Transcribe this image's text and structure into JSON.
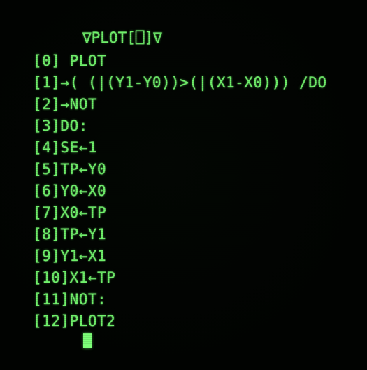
{
  "editor": {
    "header": "∇PLOT[⎕]∇",
    "lines": [
      "[0] PLOT",
      "[1]→( (|(Y1-Y0))>(|(X1-X0))) /DO",
      "[2]→NOT",
      "[3]DO:",
      "[4]SE←1",
      "[5]TP←Y0",
      "[6]Y0←X0",
      "[7]X0←TP",
      "[8]TP←Y1",
      "[9]Y1←X1",
      "[10]X1←TP",
      "[11]NOT:",
      "[12]PLOT2"
    ]
  },
  "colors": {
    "phosphor": "#6ff06a",
    "background": "#010301",
    "cursor": "#7dff78"
  }
}
